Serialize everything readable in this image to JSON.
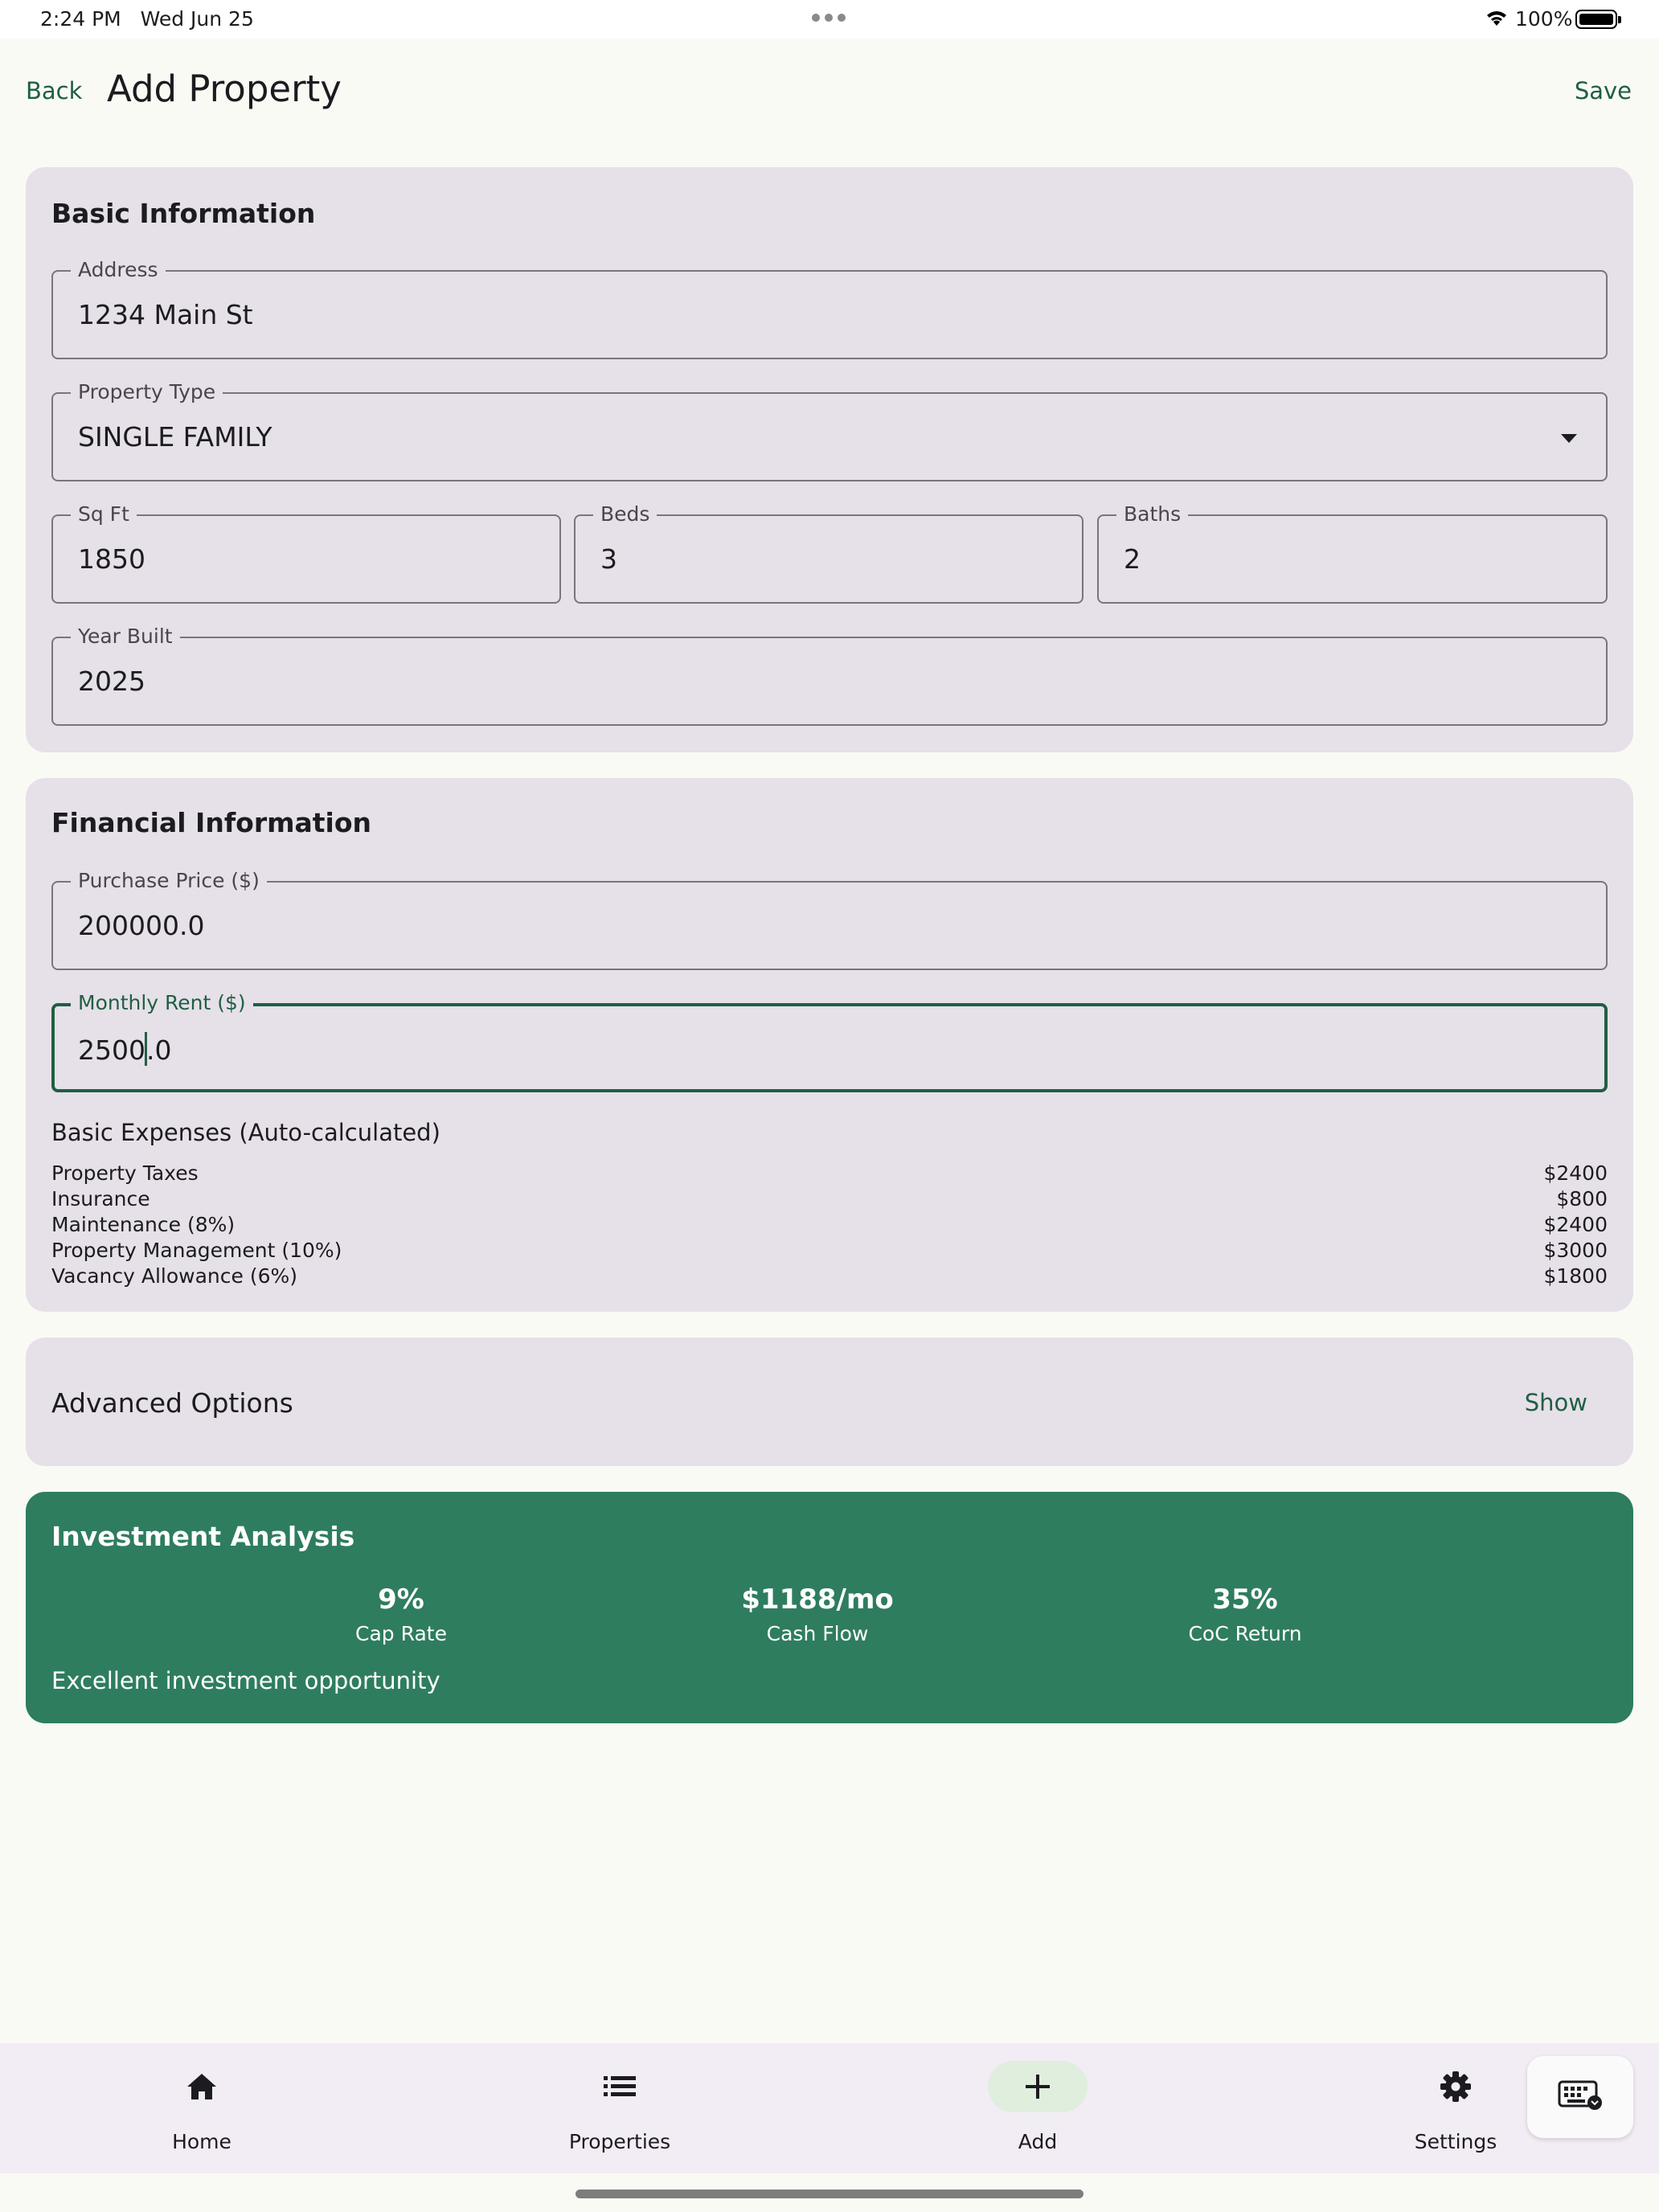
{
  "status_bar": {
    "time": "2:24 PM",
    "date": "Wed Jun 25",
    "battery": "100%"
  },
  "header": {
    "back_label": "Back",
    "title": "Add Property",
    "save_label": "Save"
  },
  "basic_info": {
    "title": "Basic Information",
    "address": {
      "label": "Address",
      "value": "1234 Main St"
    },
    "property_type": {
      "label": "Property Type",
      "value": "SINGLE FAMILY"
    },
    "sqft": {
      "label": "Sq Ft",
      "value": "1850"
    },
    "beds": {
      "label": "Beds",
      "value": "3"
    },
    "baths": {
      "label": "Baths",
      "value": "2"
    },
    "year_built": {
      "label": "Year Built",
      "value": "2025"
    }
  },
  "financial_info": {
    "title": "Financial Information",
    "purchase_price": {
      "label": "Purchase Price ($)",
      "value": "200000.0"
    },
    "monthly_rent": {
      "label": "Monthly Rent ($)",
      "value_before_cursor": "2500",
      "value_after_cursor": ".0"
    },
    "expenses_title": "Basic Expenses (Auto-calculated)",
    "expenses": [
      {
        "label": "Property Taxes",
        "value": "$2400"
      },
      {
        "label": "Insurance",
        "value": "$800"
      },
      {
        "label": "Maintenance (8%)",
        "value": "$2400"
      },
      {
        "label": "Property Management (10%)",
        "value": "$3000"
      },
      {
        "label": "Vacancy Allowance (6%)",
        "value": "$1800"
      }
    ]
  },
  "advanced": {
    "title": "Advanced Options",
    "toggle_label": "Show"
  },
  "investment": {
    "title": "Investment Analysis",
    "metrics": [
      {
        "value": "9%",
        "label": "Cap Rate"
      },
      {
        "value": "$1188/mo",
        "label": "Cash Flow"
      },
      {
        "value": "35%",
        "label": "CoC Return"
      }
    ],
    "verdict": "Excellent investment opportunity"
  },
  "nav": {
    "items": [
      {
        "label": "Home",
        "icon": "home-icon"
      },
      {
        "label": "Properties",
        "icon": "list-icon"
      },
      {
        "label": "Add",
        "icon": "plus-icon",
        "active": true
      },
      {
        "label": "Settings",
        "icon": "gear-icon"
      }
    ]
  },
  "colors": {
    "primary": "#1f5f43",
    "analysis_bg": "#2e7d5f",
    "card_bg": "#e6e0e8",
    "page_bg": "#fafaf5"
  }
}
